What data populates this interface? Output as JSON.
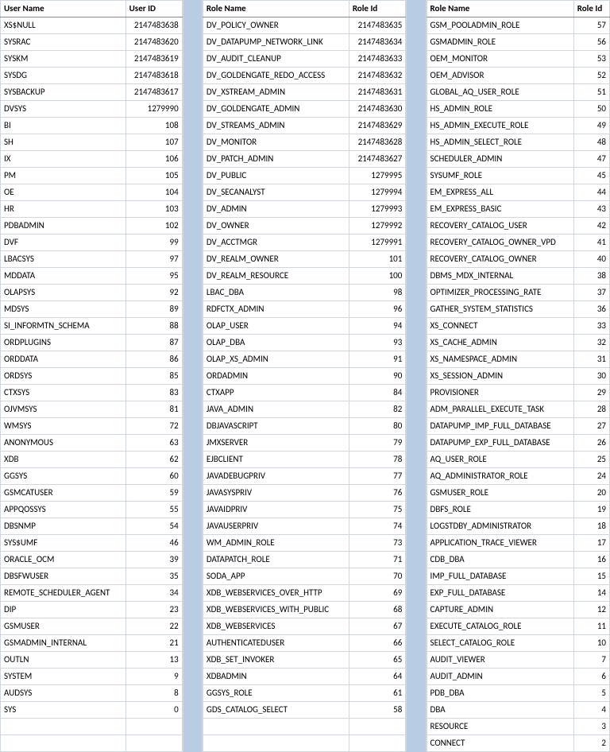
{
  "t1": {
    "headers": {
      "name": "User Name",
      "id": "User ID"
    },
    "rows": [
      {
        "name": "XS$NULL",
        "id": "2147483638"
      },
      {
        "name": "SYSRAC",
        "id": "2147483620"
      },
      {
        "name": "SYSKM",
        "id": "2147483619"
      },
      {
        "name": "SYSDG",
        "id": "2147483618"
      },
      {
        "name": "SYSBACKUP",
        "id": "2147483617"
      },
      {
        "name": "DVSYS",
        "id": "1279990"
      },
      {
        "name": "BI",
        "id": "108"
      },
      {
        "name": "SH",
        "id": "107"
      },
      {
        "name": "IX",
        "id": "106"
      },
      {
        "name": "PM",
        "id": "105"
      },
      {
        "name": "OE",
        "id": "104"
      },
      {
        "name": "HR",
        "id": "103"
      },
      {
        "name": "PDBADMIN",
        "id": "102"
      },
      {
        "name": "DVF",
        "id": "99"
      },
      {
        "name": "LBACSYS",
        "id": "97"
      },
      {
        "name": "MDDATA",
        "id": "95"
      },
      {
        "name": "OLAPSYS",
        "id": "92"
      },
      {
        "name": "MDSYS",
        "id": "89"
      },
      {
        "name": "SI_INFORMTN_SCHEMA",
        "id": "88"
      },
      {
        "name": "ORDPLUGINS",
        "id": "87"
      },
      {
        "name": "ORDDATA",
        "id": "86"
      },
      {
        "name": "ORDSYS",
        "id": "85"
      },
      {
        "name": "CTXSYS",
        "id": "83"
      },
      {
        "name": "OJVMSYS",
        "id": "81"
      },
      {
        "name": "WMSYS",
        "id": "72"
      },
      {
        "name": "ANONYMOUS",
        "id": "63"
      },
      {
        "name": "XDB",
        "id": "62"
      },
      {
        "name": "GGSYS",
        "id": "60"
      },
      {
        "name": "GSMCATUSER",
        "id": "59"
      },
      {
        "name": "APPQOSSYS",
        "id": "55"
      },
      {
        "name": "DBSNMP",
        "id": "54"
      },
      {
        "name": "SYS$UMF",
        "id": "46"
      },
      {
        "name": "ORACLE_OCM",
        "id": "39"
      },
      {
        "name": "DBSFWUSER",
        "id": "35"
      },
      {
        "name": "REMOTE_SCHEDULER_AGENT",
        "id": "34"
      },
      {
        "name": "DIP",
        "id": "23"
      },
      {
        "name": "GSMUSER",
        "id": "22"
      },
      {
        "name": "GSMADMIN_INTERNAL",
        "id": "21"
      },
      {
        "name": "OUTLN",
        "id": "13"
      },
      {
        "name": "SYSTEM",
        "id": "9"
      },
      {
        "name": "AUDSYS",
        "id": "8"
      },
      {
        "name": "SYS",
        "id": "0"
      }
    ]
  },
  "t2": {
    "headers": {
      "name": "Role Name",
      "id": "Role Id"
    },
    "rows": [
      {
        "name": "DV_POLICY_OWNER",
        "id": "2147483635"
      },
      {
        "name": "DV_DATAPUMP_NETWORK_LINK",
        "id": "2147483634"
      },
      {
        "name": "DV_AUDIT_CLEANUP",
        "id": "2147483633"
      },
      {
        "name": "DV_GOLDENGATE_REDO_ACCESS",
        "id": "2147483632"
      },
      {
        "name": "DV_XSTREAM_ADMIN",
        "id": "2147483631"
      },
      {
        "name": "DV_GOLDENGATE_ADMIN",
        "id": "2147483630"
      },
      {
        "name": "DV_STREAMS_ADMIN",
        "id": "2147483629"
      },
      {
        "name": "DV_MONITOR",
        "id": "2147483628"
      },
      {
        "name": "DV_PATCH_ADMIN",
        "id": "2147483627"
      },
      {
        "name": "DV_PUBLIC",
        "id": "1279995"
      },
      {
        "name": "DV_SECANALYST",
        "id": "1279994"
      },
      {
        "name": "DV_ADMIN",
        "id": "1279993"
      },
      {
        "name": "DV_OWNER",
        "id": "1279992"
      },
      {
        "name": "DV_ACCTMGR",
        "id": "1279991"
      },
      {
        "name": "DV_REALM_OWNER",
        "id": "101"
      },
      {
        "name": "DV_REALM_RESOURCE",
        "id": "100"
      },
      {
        "name": "LBAC_DBA",
        "id": "98"
      },
      {
        "name": "RDFCTX_ADMIN",
        "id": "96"
      },
      {
        "name": "OLAP_USER",
        "id": "94"
      },
      {
        "name": "OLAP_DBA",
        "id": "93"
      },
      {
        "name": "OLAP_XS_ADMIN",
        "id": "91"
      },
      {
        "name": "ORDADMIN",
        "id": "90"
      },
      {
        "name": "CTXAPP",
        "id": "84"
      },
      {
        "name": "JAVA_ADMIN",
        "id": "82"
      },
      {
        "name": "DBJAVASCRIPT",
        "id": "80"
      },
      {
        "name": "JMXSERVER",
        "id": "79"
      },
      {
        "name": "EJBCLIENT",
        "id": "78"
      },
      {
        "name": "JAVADEBUGPRIV",
        "id": "77"
      },
      {
        "name": "JAVASYSPRIV",
        "id": "76"
      },
      {
        "name": "JAVAIDPRIV",
        "id": "75"
      },
      {
        "name": "JAVAUSERPRIV",
        "id": "74"
      },
      {
        "name": "WM_ADMIN_ROLE",
        "id": "73"
      },
      {
        "name": "DATAPATCH_ROLE",
        "id": "71"
      },
      {
        "name": "SODA_APP",
        "id": "70"
      },
      {
        "name": "XDB_WEBSERVICES_OVER_HTTP",
        "id": "69"
      },
      {
        "name": "XDB_WEBSERVICES_WITH_PUBLIC",
        "id": "68"
      },
      {
        "name": "XDB_WEBSERVICES",
        "id": "67"
      },
      {
        "name": "AUTHENTICATEDUSER",
        "id": "66"
      },
      {
        "name": "XDB_SET_INVOKER",
        "id": "65"
      },
      {
        "name": "XDBADMIN",
        "id": "64"
      },
      {
        "name": "GGSYS_ROLE",
        "id": "61"
      },
      {
        "name": "GDS_CATALOG_SELECT",
        "id": "58"
      }
    ]
  },
  "t3": {
    "headers": {
      "name": "Role Name",
      "id": "Role Id"
    },
    "rows": [
      {
        "name": "GSM_POOLADMIN_ROLE",
        "id": "57"
      },
      {
        "name": "GSMADMIN_ROLE",
        "id": "56"
      },
      {
        "name": "OEM_MONITOR",
        "id": "53"
      },
      {
        "name": "OEM_ADVISOR",
        "id": "52"
      },
      {
        "name": "GLOBAL_AQ_USER_ROLE",
        "id": "51"
      },
      {
        "name": "HS_ADMIN_ROLE",
        "id": "50"
      },
      {
        "name": "HS_ADMIN_EXECUTE_ROLE",
        "id": "49"
      },
      {
        "name": "HS_ADMIN_SELECT_ROLE",
        "id": "48"
      },
      {
        "name": "SCHEDULER_ADMIN",
        "id": "47"
      },
      {
        "name": "SYSUMF_ROLE",
        "id": "45"
      },
      {
        "name": "EM_EXPRESS_ALL",
        "id": "44"
      },
      {
        "name": "EM_EXPRESS_BASIC",
        "id": "43"
      },
      {
        "name": "RECOVERY_CATALOG_USER",
        "id": "42"
      },
      {
        "name": "RECOVERY_CATALOG_OWNER_VPD",
        "id": "41"
      },
      {
        "name": "RECOVERY_CATALOG_OWNER",
        "id": "40"
      },
      {
        "name": "DBMS_MDX_INTERNAL",
        "id": "38"
      },
      {
        "name": "OPTIMIZER_PROCESSING_RATE",
        "id": "37"
      },
      {
        "name": "GATHER_SYSTEM_STATISTICS",
        "id": "36"
      },
      {
        "name": "XS_CONNECT",
        "id": "33"
      },
      {
        "name": "XS_CACHE_ADMIN",
        "id": "32"
      },
      {
        "name": "XS_NAMESPACE_ADMIN",
        "id": "31"
      },
      {
        "name": "XS_SESSION_ADMIN",
        "id": "30"
      },
      {
        "name": "PROVISIONER",
        "id": "29"
      },
      {
        "name": "ADM_PARALLEL_EXECUTE_TASK",
        "id": "28"
      },
      {
        "name": "DATAPUMP_IMP_FULL_DATABASE",
        "id": "27"
      },
      {
        "name": "DATAPUMP_EXP_FULL_DATABASE",
        "id": "26"
      },
      {
        "name": "AQ_USER_ROLE",
        "id": "25"
      },
      {
        "name": "AQ_ADMINISTRATOR_ROLE",
        "id": "24"
      },
      {
        "name": "GSMUSER_ROLE",
        "id": "20"
      },
      {
        "name": "DBFS_ROLE",
        "id": "19"
      },
      {
        "name": "LOGSTDBY_ADMINISTRATOR",
        "id": "18"
      },
      {
        "name": "APPLICATION_TRACE_VIEWER",
        "id": "17"
      },
      {
        "name": "CDB_DBA",
        "id": "16"
      },
      {
        "name": "IMP_FULL_DATABASE",
        "id": "15"
      },
      {
        "name": "EXP_FULL_DATABASE",
        "id": "14"
      },
      {
        "name": "CAPTURE_ADMIN",
        "id": "12"
      },
      {
        "name": "EXECUTE_CATALOG_ROLE",
        "id": "11"
      },
      {
        "name": "SELECT_CATALOG_ROLE",
        "id": "10"
      },
      {
        "name": "AUDIT_VIEWER",
        "id": "7"
      },
      {
        "name": "AUDIT_ADMIN",
        "id": "6"
      },
      {
        "name": "PDB_DBA",
        "id": "5"
      },
      {
        "name": "DBA",
        "id": "4"
      },
      {
        "name": "RESOURCE",
        "id": "3"
      },
      {
        "name": "CONNECT",
        "id": "2"
      }
    ]
  }
}
